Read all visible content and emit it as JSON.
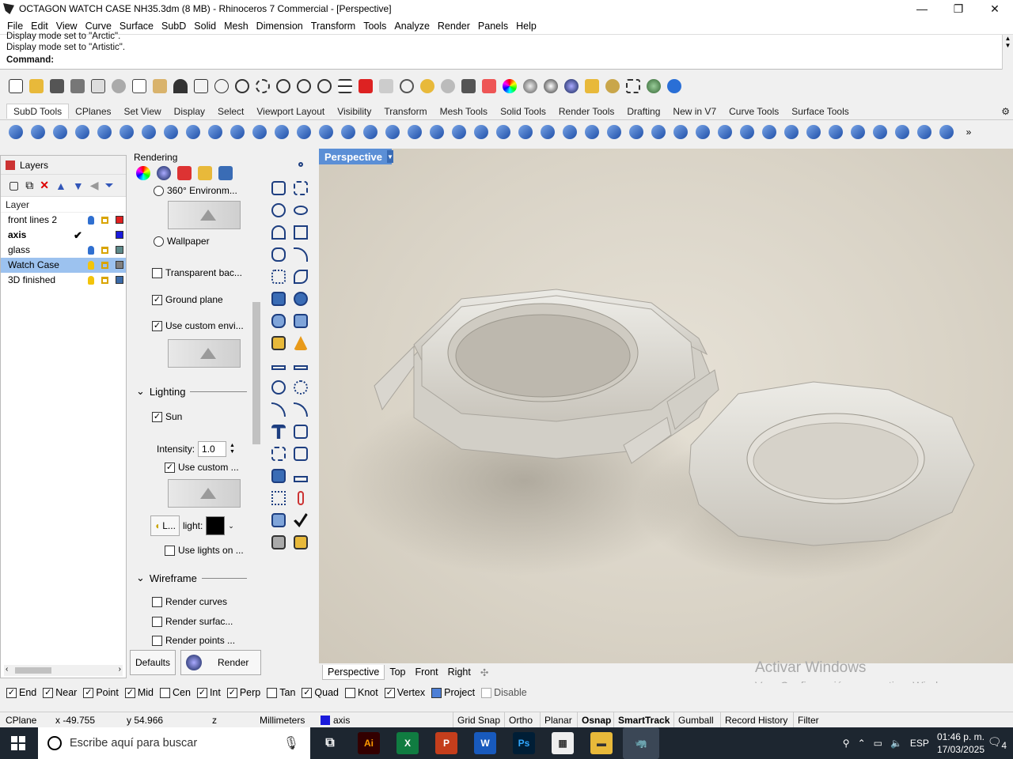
{
  "window": {
    "title": "OCTAGON WATCH CASE NH35.3dm (8 MB) - Rhinoceros 7 Commercial - [Perspective]",
    "minimize": "—",
    "maximize": "❐",
    "close": "✕"
  },
  "menu": [
    "File",
    "Edit",
    "View",
    "Curve",
    "Surface",
    "SubD",
    "Solid",
    "Mesh",
    "Dimension",
    "Transform",
    "Tools",
    "Analyze",
    "Render",
    "Panels",
    "Help"
  ],
  "command_history": [
    "Display mode set to \"Arctic\".",
    "Display mode set to \"Artistic\"."
  ],
  "command_prompt": "Command:",
  "toolbar_tabs": [
    "SubD Tools",
    "CPlanes",
    "Set View",
    "Display",
    "Select",
    "Viewport Layout",
    "Visibility",
    "Transform",
    "Mesh Tools",
    "Solid Tools",
    "Render Tools",
    "Drafting",
    "New in V7",
    "Curve Tools",
    "Surface Tools"
  ],
  "active_toolbar_tab": "SubD Tools",
  "layers_panel": {
    "title": "Layers",
    "column_header": "Layer",
    "layers": [
      {
        "name": "front lines 2",
        "color": "#e02020",
        "current": false,
        "selected": false
      },
      {
        "name": "axis",
        "color": "#1a1adc",
        "current": true,
        "selected": false
      },
      {
        "name": "glass",
        "color": "#5d8a8a",
        "current": false,
        "selected": false
      },
      {
        "name": "Watch Case",
        "color": "#808080",
        "current": false,
        "selected": true
      },
      {
        "name": "3D finished",
        "color": "#3a6aa8",
        "current": false,
        "selected": false
      }
    ]
  },
  "rendering_panel": {
    "title": "Rendering",
    "env_360": "360° Environm...",
    "wallpaper": "Wallpaper",
    "transparent_bg": "Transparent bac...",
    "ground_plane": "Ground plane",
    "use_custom_env": "Use custom envi...",
    "lighting_section": "Lighting",
    "sun": "Sun",
    "intensity_label": "Intensity:",
    "intensity_value": "1.0",
    "use_custom": "Use custom ...",
    "light_button": "L...",
    "light_label": "light:",
    "use_lights": "Use lights on ...",
    "wireframe_section": "Wireframe",
    "render_curves": "Render curves",
    "render_surfaces": "Render surfac...",
    "render_points": "Render points ...",
    "defaults_button": "Defaults",
    "render_button": "Render",
    "ground_plane_checked": true,
    "use_custom_env_checked": true,
    "sun_checked": true,
    "use_custom_checked": true
  },
  "viewport": {
    "active_tab": "Perspective",
    "tabs": [
      "Perspective",
      "Top",
      "Front",
      "Right"
    ],
    "add_tab": "✣"
  },
  "osnap": [
    {
      "label": "End",
      "checked": true
    },
    {
      "label": "Near",
      "checked": true
    },
    {
      "label": "Point",
      "checked": true
    },
    {
      "label": "Mid",
      "checked": true
    },
    {
      "label": "Cen",
      "checked": false
    },
    {
      "label": "Int",
      "checked": true
    },
    {
      "label": "Perp",
      "checked": true
    },
    {
      "label": "Tan",
      "checked": false
    },
    {
      "label": "Quad",
      "checked": true
    },
    {
      "label": "Knot",
      "checked": false
    },
    {
      "label": "Vertex",
      "checked": true
    },
    {
      "label": "Project",
      "checked": false
    },
    {
      "label": "Disable",
      "checked": false
    }
  ],
  "status": {
    "cplane": "CPlane",
    "x": "x -49.755",
    "y": "y 54.966",
    "z": "z",
    "units": "Millimeters",
    "layer": "axis",
    "layer_color": "#1a1adc",
    "toggles": [
      {
        "label": "Grid Snap",
        "bold": false
      },
      {
        "label": "Ortho",
        "bold": false
      },
      {
        "label": "Planar",
        "bold": false
      },
      {
        "label": "Osnap",
        "bold": true
      },
      {
        "label": "SmartTrack",
        "bold": true
      },
      {
        "label": "Gumball",
        "bold": false
      },
      {
        "label": "Record History",
        "bold": false
      },
      {
        "label": "Filter",
        "bold": false
      }
    ]
  },
  "activation_watermark": {
    "line1": "Activar Windows",
    "line2": "Ve a Configuración para activar Windows."
  },
  "taskbar": {
    "search_placeholder": "Escribe aquí para buscar",
    "language": "ESP",
    "time": "01:46 p. m.",
    "date": "17/03/2025",
    "notifications": "4",
    "apps": [
      {
        "label": "Ai",
        "color": "#ff9a00",
        "bg": "#330000"
      },
      {
        "label": "X",
        "color": "#ffffff",
        "bg": "#107c41"
      },
      {
        "label": "P",
        "color": "#ffffff",
        "bg": "#c43e1c"
      },
      {
        "label": "W",
        "color": "#ffffff",
        "bg": "#185abd"
      },
      {
        "label": "Ps",
        "color": "#31a8ff",
        "bg": "#001e36"
      }
    ]
  }
}
